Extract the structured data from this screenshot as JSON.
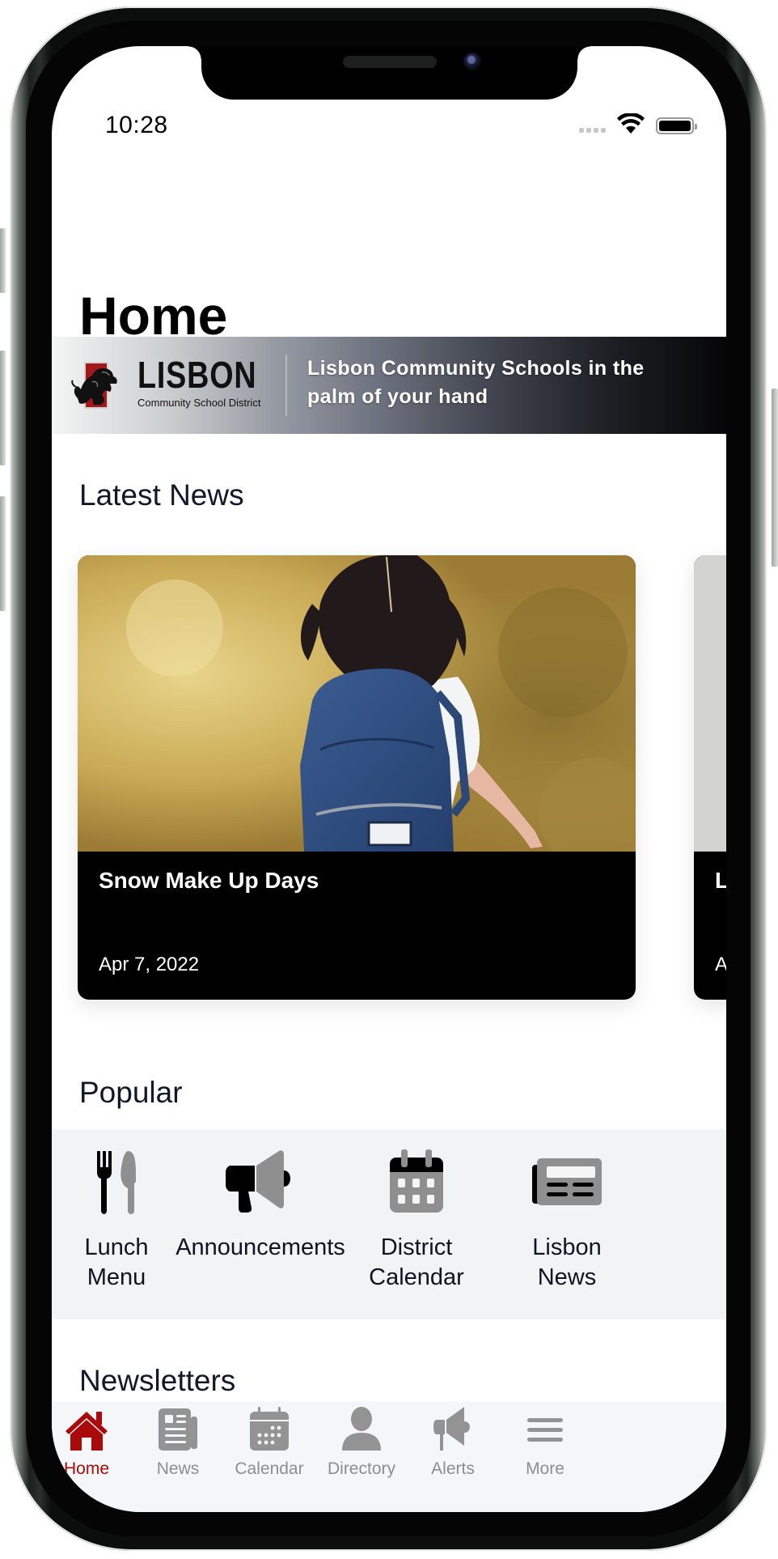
{
  "status_bar": {
    "time": "10:28",
    "icons": [
      "signal-icon",
      "wifi-icon",
      "battery-icon"
    ]
  },
  "page": {
    "title": "Home"
  },
  "banner": {
    "logo_word": "LISBON",
    "logo_subtitle": "Community School District",
    "tagline": "Lisbon Community Schools in the palm of your hand"
  },
  "latest_news": {
    "heading": "Latest News",
    "cards": [
      {
        "title": "Snow Make Up Days",
        "date": "Apr 7, 2022",
        "image": "girl-with-blue-backpack-photo"
      },
      {
        "title": "L",
        "date": "A",
        "image": "placeholder-gray"
      }
    ]
  },
  "popular": {
    "heading": "Popular",
    "items": [
      {
        "label": "Lunch Menu",
        "line1": "Lunch",
        "line2": "Menu",
        "icon": "fork-knife-icon"
      },
      {
        "label": "Announcements",
        "line1": "Announcements",
        "line2": "",
        "icon": "megaphone-icon"
      },
      {
        "label": "District Calendar",
        "line1": "District",
        "line2": "Calendar",
        "icon": "calendar-icon"
      },
      {
        "label": "Lisbon News",
        "line1": "Lisbon",
        "line2": "News",
        "icon": "newspaper-icon"
      }
    ]
  },
  "newsletters": {
    "heading": "Newsletters"
  },
  "tabbar": {
    "active": "Home",
    "tabs": [
      {
        "label": "Home",
        "icon": "home-icon"
      },
      {
        "label": "News",
        "icon": "newspaper-icon"
      },
      {
        "label": "Calendar",
        "icon": "calendar-icon"
      },
      {
        "label": "Directory",
        "icon": "person-icon"
      },
      {
        "label": "Alerts",
        "icon": "megaphone-icon"
      },
      {
        "label": "More",
        "icon": "menu-icon"
      }
    ]
  },
  "colors": {
    "accent": "#AA0A0A",
    "tab_inactive": "#8E8E8E",
    "heading": "#111827",
    "popular_bg": "#F2F3F5",
    "tabbar_bg": "#F5F6F7"
  }
}
